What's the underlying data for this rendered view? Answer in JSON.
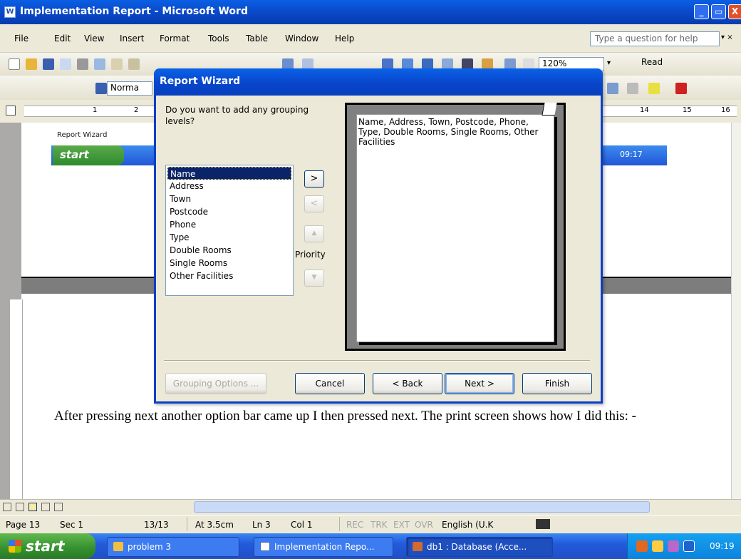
{
  "window": {
    "title": "Implementation Report - Microsoft Word",
    "app_icon": "W",
    "controls": {
      "minimize": "_",
      "maximize": "▭",
      "close": "X"
    }
  },
  "menubar": {
    "items": [
      "File",
      "Edit",
      "View",
      "Insert",
      "Format",
      "Tools",
      "Table",
      "Window",
      "Help"
    ],
    "ask_placeholder": "Type a question for help",
    "ask_arrow": "▾ ×"
  },
  "toolbar": {
    "zoom": "120%",
    "zoom_arrow": "▾",
    "read_label": "Read",
    "style_value": "Norma"
  },
  "ruler": {
    "marks": [
      "1",
      "2",
      "14",
      "15",
      "16"
    ]
  },
  "embedded": {
    "title": "Report Wizard",
    "start": "start",
    "clock": "09:17"
  },
  "document": {
    "paragraph": "After pressing next another option bar came up I then pressed next.  The print screen shows how I did this: -"
  },
  "dialog": {
    "title": "Report Wizard",
    "question": "Do you want to add any grouping levels?",
    "fields": [
      "Name",
      "Address",
      "Town",
      "Postcode",
      "Phone",
      "Type",
      "Double Rooms",
      "Single Rooms",
      "Other Facilities"
    ],
    "selected_field": "Name",
    "arrows": {
      "add": ">",
      "remove": "<",
      "up": "▲",
      "down": "▼"
    },
    "priority_label": "Priority",
    "preview_text": "Name, Address, Town, Postcode, Phone, Type, Double Rooms, Single Rooms, Other Facilities",
    "buttons": {
      "grouping_options": "Grouping Options ...",
      "cancel": "Cancel",
      "back": "< Back",
      "next": "Next >",
      "finish": "Finish"
    }
  },
  "statusbar": {
    "page": "Page 13",
    "section": "Sec 1",
    "pages": "13/13",
    "at": "At 3.5cm",
    "line": "Ln 3",
    "col": "Col 1",
    "rec": "REC",
    "trk": "TRK",
    "ext": "EXT",
    "ovr": "OVR",
    "language": "English (U.K"
  },
  "taskbar": {
    "start": "start",
    "tasks": [
      "problem 3",
      "Implementation Repo...",
      "db1 : Database (Acce..."
    ],
    "clock": "09:19"
  }
}
